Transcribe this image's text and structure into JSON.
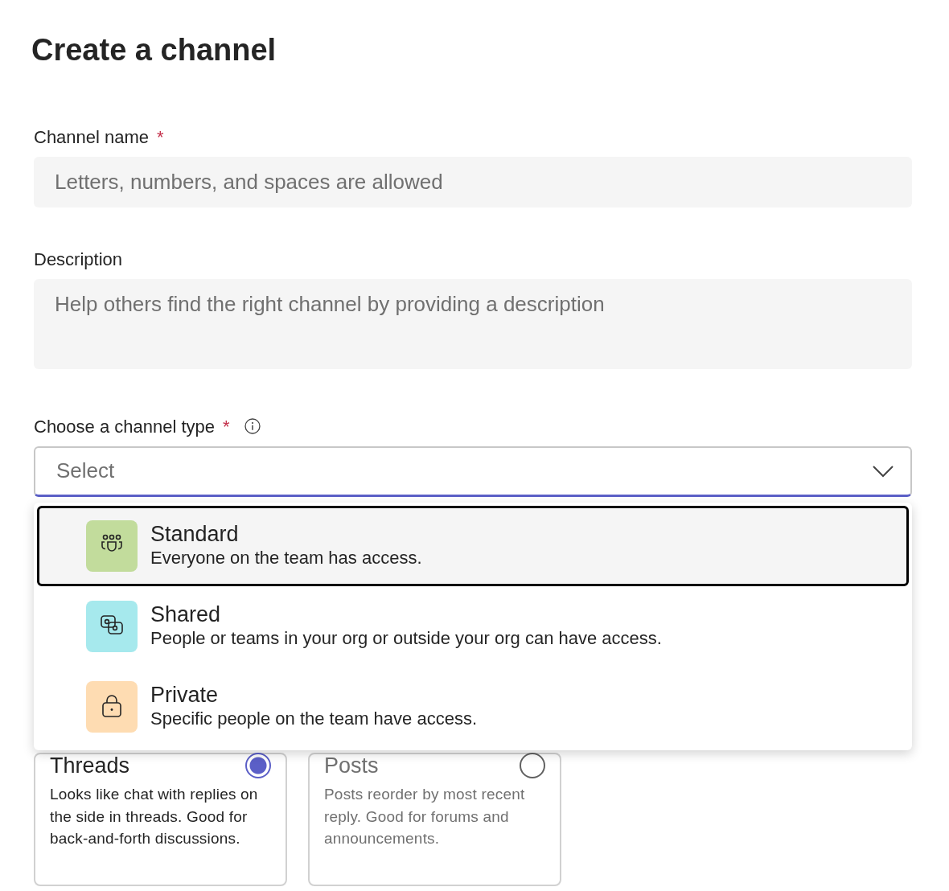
{
  "title": "Create a channel",
  "fields": [
    {
      "kind": "text",
      "label": "Channel name",
      "required_mark": "*",
      "placeholder": "Letters, numbers, and spaces are allowed"
    },
    {
      "kind": "textarea",
      "label": "Description",
      "placeholder": "Help others find the right channel by providing a description"
    }
  ],
  "channel_type": {
    "label": "Choose a channel type",
    "required_mark": "*",
    "placeholder": "Select",
    "expanded": true,
    "options": [
      {
        "kind": "people",
        "title": "Standard",
        "description": "Everyone on the team has access.",
        "color": "#c2dc9c",
        "focused": true
      },
      {
        "kind": "shared",
        "title": "Shared",
        "description": "People or teams in your org or outside your org can have access.",
        "color": "#a6e9ed",
        "focused": false
      },
      {
        "kind": "lock",
        "title": "Private",
        "description": "Specific people on the team have access.",
        "color": "#fedcb2",
        "focused": false
      }
    ]
  },
  "layouts": [
    {
      "title": "Threads",
      "description": "Looks like chat with replies on the side in threads. Good for back-and-forth discussions.",
      "selected": true,
      "disabled": false
    },
    {
      "title": "Posts",
      "description": "Posts reorder by most recent reply. Good for forums and announcements.",
      "selected": false,
      "disabled": true
    }
  ]
}
